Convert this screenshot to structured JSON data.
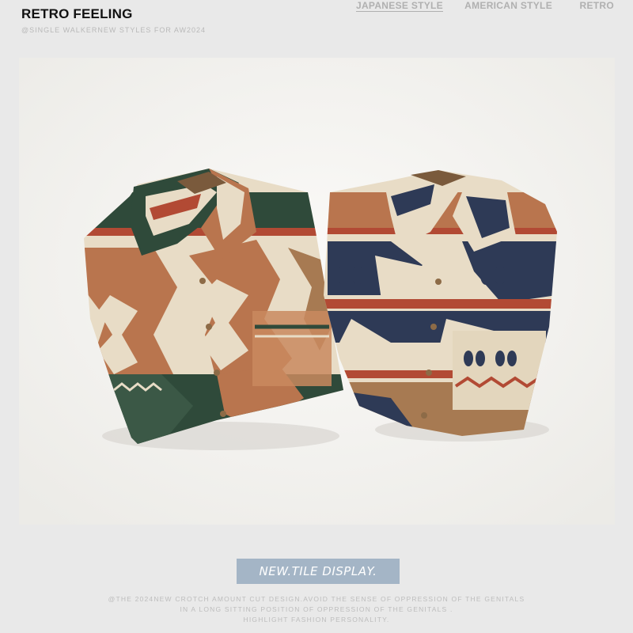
{
  "header": {
    "title": "RETRO FEELING",
    "subtitle": "@SINGLE WALKERNEW STYLES FOR AW2024"
  },
  "nav": {
    "items": [
      {
        "label": "JAPANESE STYLE",
        "active": true
      },
      {
        "label": "AMERICAN STYLE",
        "active": false
      },
      {
        "label": "RETRO",
        "active": false
      }
    ]
  },
  "photo": {
    "subject": "two folded aztec-pattern flannel shirts",
    "colors": {
      "background": "#f6f5f2",
      "cream": "#e8dcc6",
      "rust": "#b9754e",
      "green": "#2f4a3a",
      "red": "#b24a34",
      "navy": "#2e3a56",
      "tan": "#a77a52"
    }
  },
  "badge": {
    "label": "NEW.TILE DISPLAY."
  },
  "footer": {
    "lines": [
      "@THE 2024NEW CROTCH AMOUNT CUT DESIGN.AVOID THE SENSE OF OPPRESSION OF THE GENITALS",
      "IN A LONG SITTING POSITION OF OPPRESSION OF THE GENITALS .",
      "HIGHLIGHT FASHION PERSONALITY."
    ]
  }
}
